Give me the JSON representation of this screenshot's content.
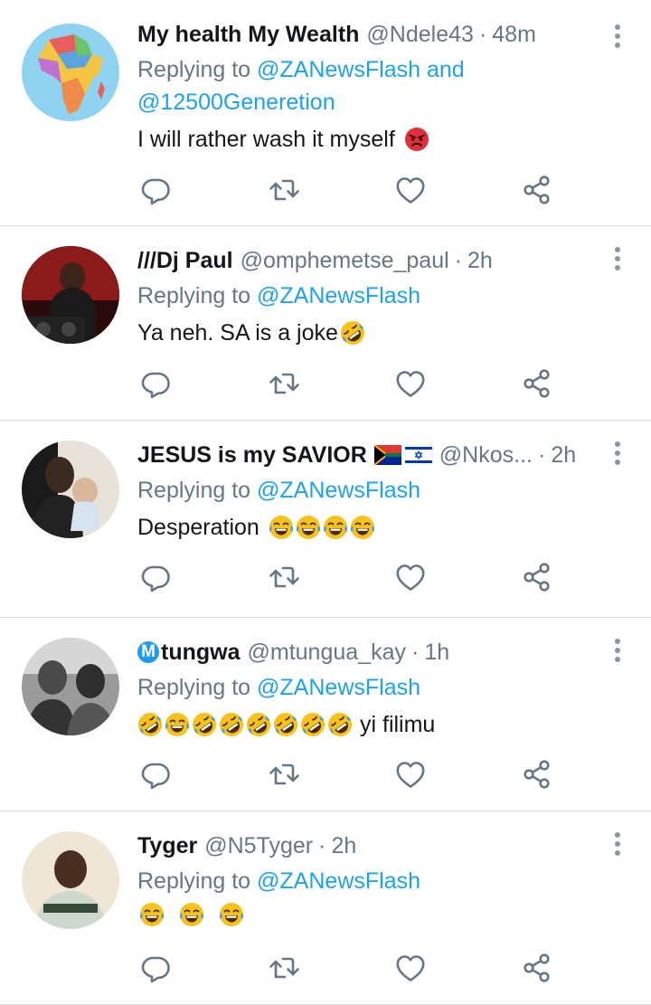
{
  "tweets": [
    {
      "name": "My health My Wealth",
      "handle": "@Ndele43",
      "time": "48m",
      "replying_prefix": "Replying to",
      "mentions_line1": "@ZANewsFlash and",
      "mentions_line2": "@12500Generetion",
      "text": "I will rather wash it myself",
      "emoji": [
        "angry-face"
      ]
    },
    {
      "name": "///Dj Paul",
      "handle": "@omphemetse_paul",
      "time": "2h",
      "replying_prefix": "Replying to",
      "mentions_line1": "@ZANewsFlash",
      "text": "Ya neh. SA is a joke",
      "emoji": [
        "rolling-laughing-face"
      ]
    },
    {
      "name": "JESUS is my SAVIOR",
      "name_flags": [
        "south-africa-flag",
        "israel-flag"
      ],
      "handle": "@Nkos...",
      "time": "2h",
      "replying_prefix": "Replying to",
      "mentions_line1": "@ZANewsFlash",
      "text": "Desperation",
      "emoji": [
        "tears-of-joy-face",
        "tears-of-joy-face",
        "tears-of-joy-face",
        "tears-of-joy-face"
      ]
    },
    {
      "name_badge": "M",
      "name": "tungwa",
      "handle": "@mtungua_kay",
      "time": "1h",
      "replying_prefix": "Replying to",
      "mentions_line1": "@ZANewsFlash",
      "text": "yi filimu",
      "emoji": [
        "rolling-laughing-face",
        "tears-of-joy-face",
        "rolling-laughing-face",
        "rolling-laughing-face",
        "rolling-laughing-face",
        "rolling-laughing-face",
        "rolling-laughing-face",
        "rolling-laughing-face"
      ]
    },
    {
      "name": "Tyger",
      "handle": "@N5Tyger",
      "time": "2h",
      "replying_prefix": "Replying to",
      "mentions_line1": "@ZANewsFlash",
      "text": "",
      "emoji": [
        "tears-of-joy-face",
        "tears-of-joy-face",
        "tears-of-joy-face"
      ]
    }
  ],
  "separator": "·",
  "colors": {
    "name": "#14171a",
    "meta": "#657786",
    "mention": "#1da1f2",
    "divider": "#d9d9d9",
    "icon": "#657786"
  }
}
